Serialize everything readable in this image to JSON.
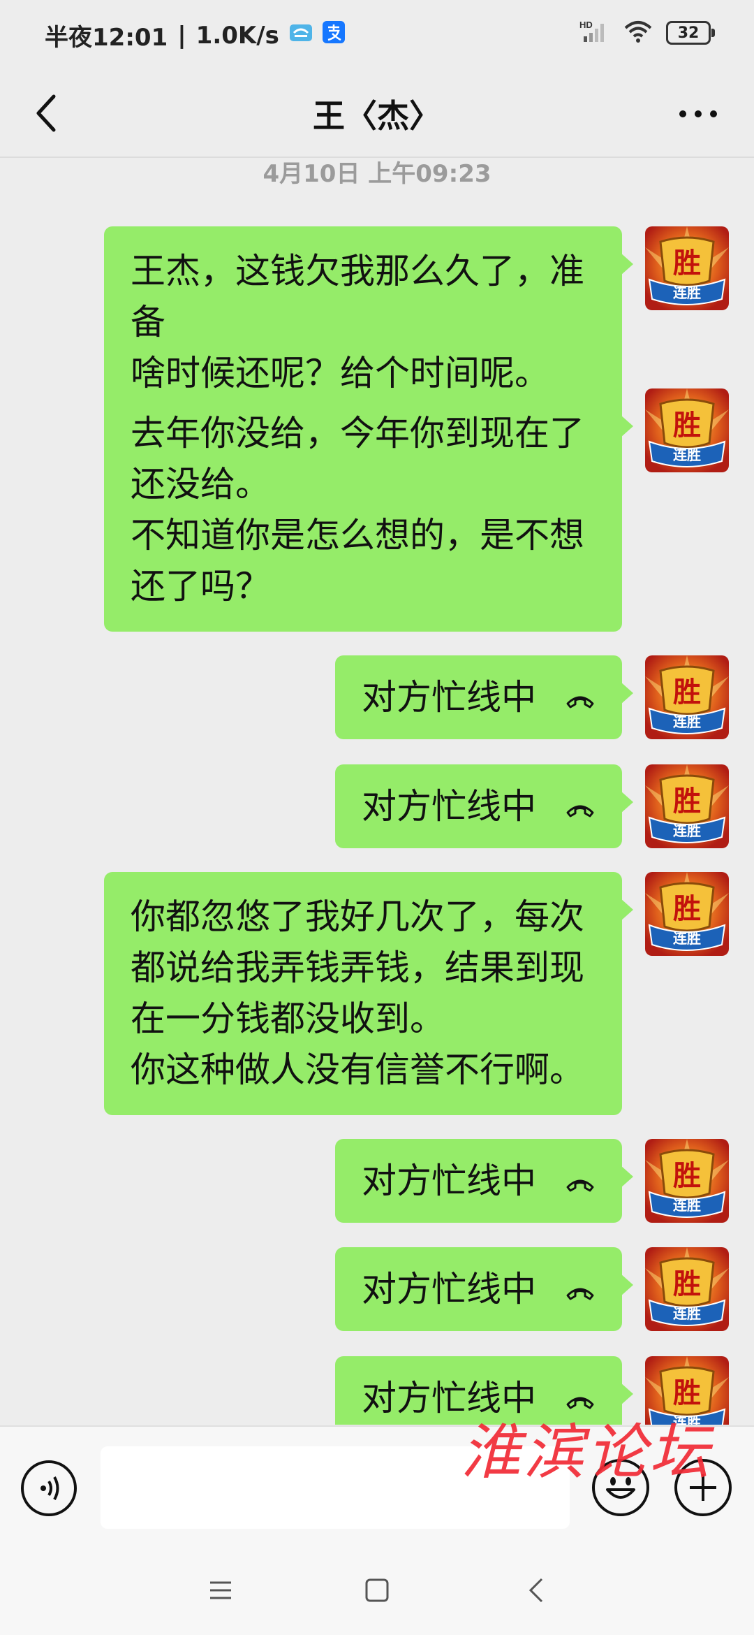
{
  "status_bar": {
    "time": "半夜12:01",
    "network_speed": "1.0K/s",
    "signal_label": "HD",
    "battery": "32"
  },
  "header": {
    "title": "王〈杰〉"
  },
  "chat": {
    "timestamp": "4月10日 上午09:23",
    "messages": [
      {
        "type": "text",
        "lines": [
          "王杰，这钱欠我那么久了，准备",
          "啥时候还呢？给个时间呢。"
        ]
      },
      {
        "type": "text",
        "lines": [
          "去年你没给，今年你到现在了",
          "还没给。",
          "不知道你是怎么想的，是不想",
          "还了吗？"
        ]
      },
      {
        "type": "call",
        "text": "对方忙线中"
      },
      {
        "type": "call",
        "text": "对方忙线中"
      },
      {
        "type": "text",
        "lines": [
          "你都忽悠了我好几次了，每次",
          "都说给我弄钱弄钱，结果到现",
          "在一分钱都没收到。",
          "你这种做人没有信誉不行啊。"
        ]
      },
      {
        "type": "call",
        "text": "对方忙线中"
      },
      {
        "type": "call",
        "text": "对方忙线中"
      },
      {
        "type": "call",
        "text": "对方忙线中"
      }
    ],
    "avatar_text": {
      "big": "胜",
      "small": "连胜"
    }
  },
  "watermark": "淮滨论坛",
  "colors": {
    "bubble": "#95ec69",
    "background": "#ededed",
    "watermark": "#f12a35"
  }
}
